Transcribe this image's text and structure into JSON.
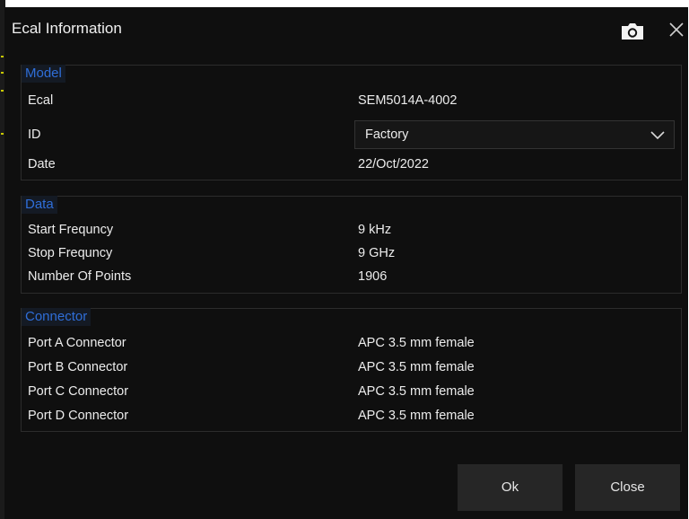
{
  "dialog": {
    "title": "Ecal Information"
  },
  "model": {
    "title": "Model",
    "ecal_label": "Ecal",
    "ecal_value": "SEM5014A-4002",
    "id_label": "ID",
    "id_value": "Factory",
    "date_label": "Date",
    "date_value": "22/Oct/2022"
  },
  "data": {
    "title": "Data",
    "rows": [
      {
        "label": "Start Frequncy",
        "value": "9 kHz"
      },
      {
        "label": "Stop Frequncy",
        "value": "9 GHz"
      },
      {
        "label": "Number Of Points",
        "value": "1906"
      }
    ]
  },
  "connector": {
    "title": "Connector",
    "rows": [
      {
        "label": "Port A Connector",
        "value": "APC 3.5 mm female"
      },
      {
        "label": "Port B Connector",
        "value": "APC 3.5 mm female"
      },
      {
        "label": "Port C Connector",
        "value": "APC 3.5 mm female"
      },
      {
        "label": "Port D Connector",
        "value": "APC 3.5 mm female"
      }
    ]
  },
  "buttons": {
    "ok": "Ok",
    "close": "Close"
  },
  "colors": {
    "background": "#0f0f0f",
    "group_title": "#2f6ed8",
    "button": "#262626"
  },
  "icons": {
    "camera": "camera-icon",
    "close": "close-icon",
    "dropdown": "chevron-down-icon"
  }
}
